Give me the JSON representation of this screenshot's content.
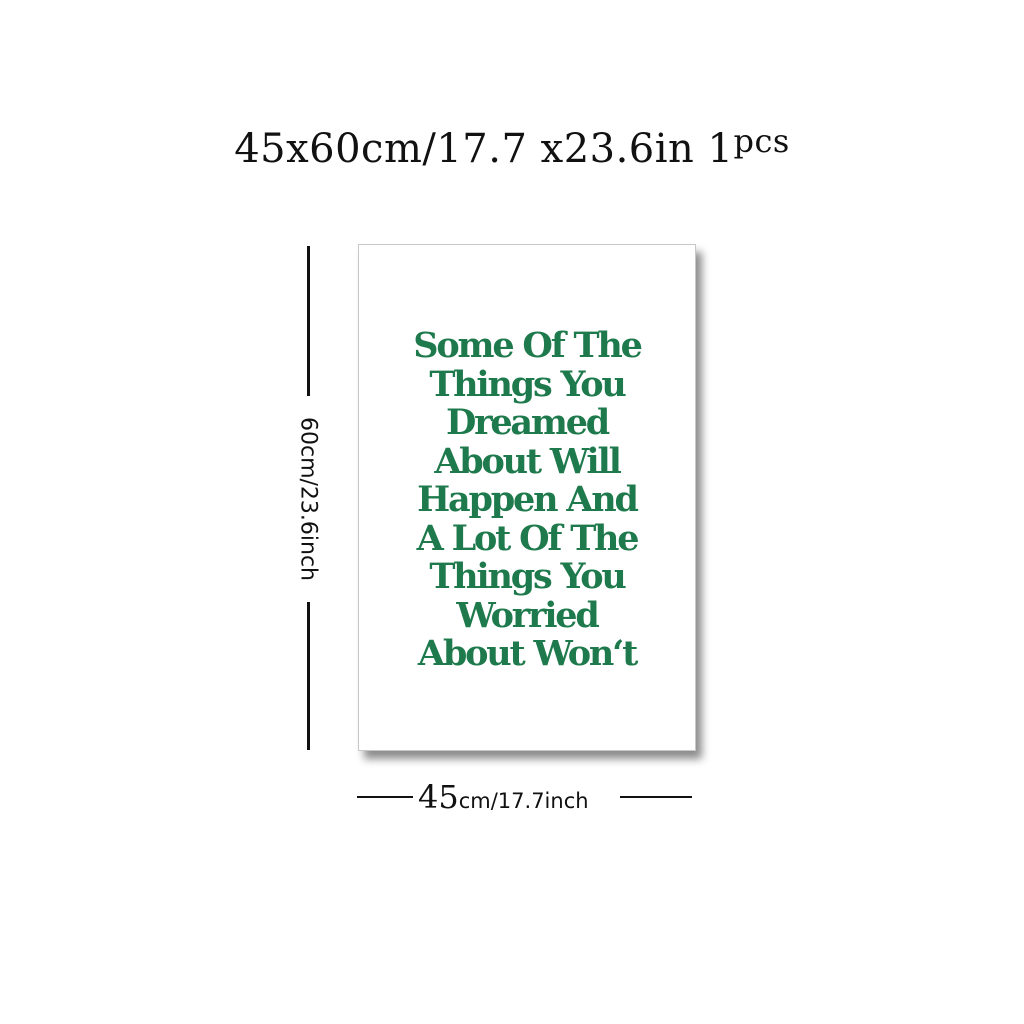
{
  "title": {
    "dimensions": "45x60cm/17.7 x23.6in",
    "quantity": "1",
    "quantity_unit": "pcs"
  },
  "poster": {
    "quote_lines": [
      "Some Of The",
      "Things You",
      "Dreamed",
      "About Will",
      "Happen And",
      "A Lot Of The",
      "Things You",
      "Worried",
      "About Won‘t"
    ],
    "text_color": "#1e7a4c"
  },
  "height_label": "60cm/23.6inch",
  "width_label": {
    "value": "45",
    "unit": "cm/17.7inch"
  }
}
